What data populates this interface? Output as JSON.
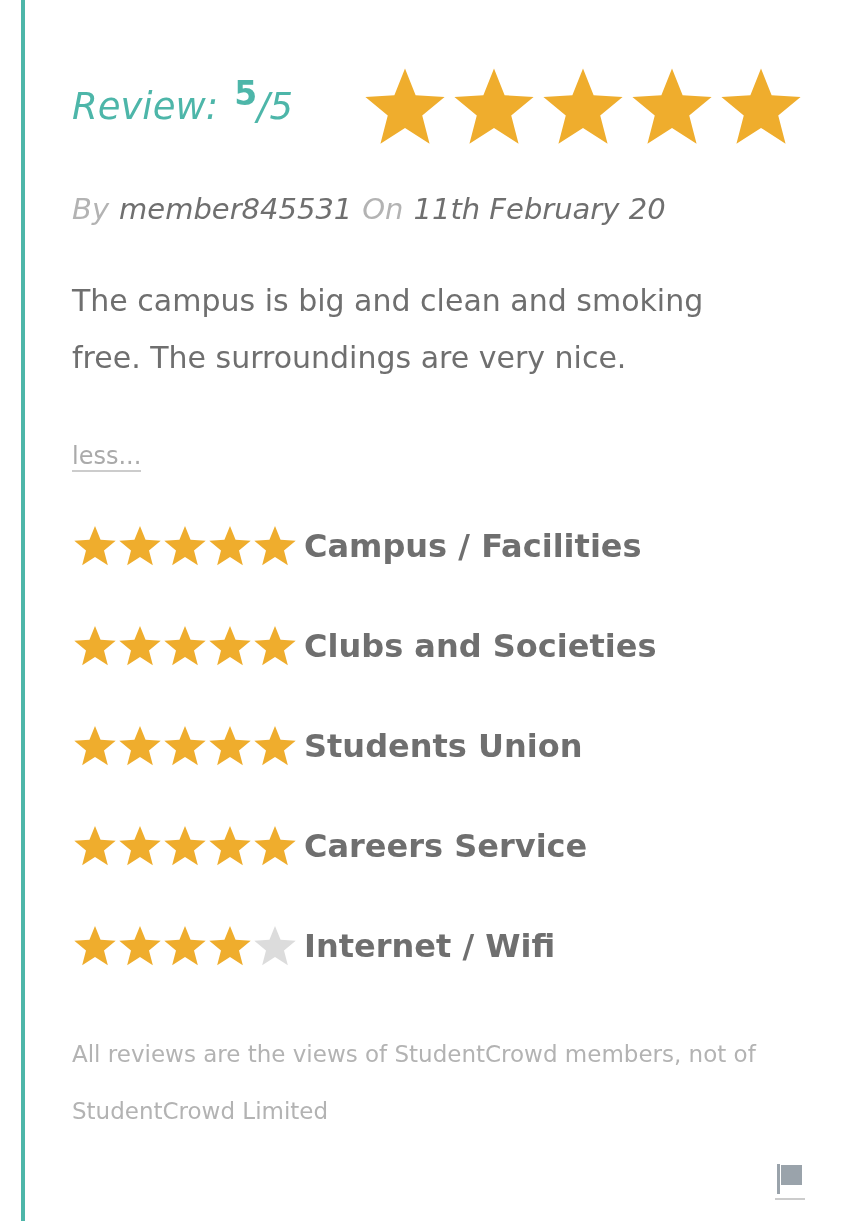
{
  "review": {
    "label": "Review:",
    "score": "5",
    "out_of": "/5",
    "stars": 5
  },
  "byline": {
    "by": "By",
    "member": "member845531",
    "on": "On",
    "date": "11th February 20"
  },
  "body": "The campus is big and clean and smoking free. The surroundings are very nice.",
  "less_link": "less...",
  "ratings": [
    {
      "label": "Campus / Facilities",
      "stars": 5
    },
    {
      "label": "Clubs and Societies",
      "stars": 5
    },
    {
      "label": "Students Union",
      "stars": 5
    },
    {
      "label": "Careers Service",
      "stars": 5
    },
    {
      "label": "Internet / Wifi",
      "stars": 4
    }
  ],
  "disclaimer": "All reviews are the views of StudentCrowd members, not of StudentCrowd Limited"
}
